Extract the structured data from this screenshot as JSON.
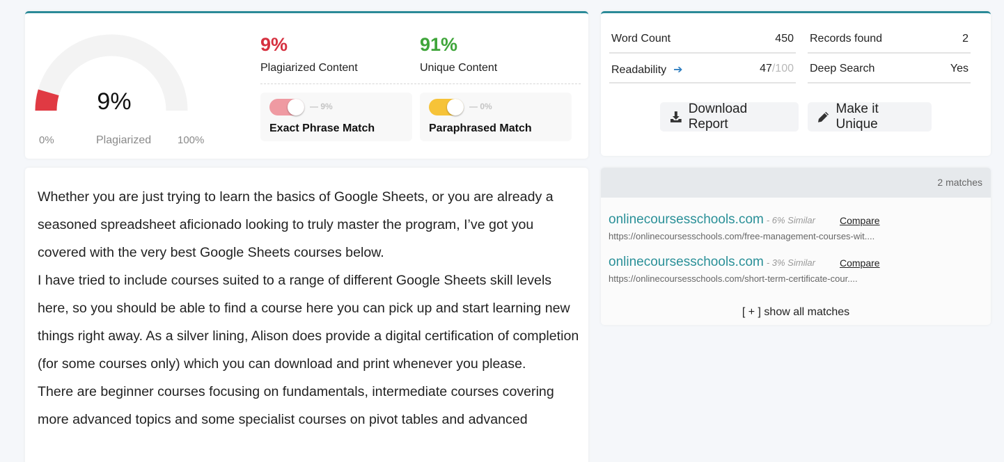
{
  "summary": {
    "gauge": {
      "value": 9,
      "value_text": "9%",
      "label": "Plagiarized",
      "min_label": "0%",
      "max_label": "100%",
      "fill_color": "#e03a43",
      "track_color": "#f3f3f3"
    },
    "plagiarized": {
      "pct": "9%",
      "label": "Plagiarized Content",
      "color": "#d6303f"
    },
    "unique": {
      "pct": "91%",
      "label": "Unique Content",
      "color": "#3fa53a"
    },
    "exact_match": {
      "toggle_on": true,
      "pct": "— 9%",
      "label": "Exact Phrase Match",
      "color": "#ef9aa2"
    },
    "paraphrased_match": {
      "toggle_on": true,
      "pct": "— 0%",
      "label": "Paraphrased Match",
      "color": "#f6c338"
    }
  },
  "info": {
    "word_count": {
      "label": "Word Count",
      "value": "450"
    },
    "readability": {
      "label": "Readability",
      "value": "47",
      "max": "/100",
      "icon": "arrow-right-icon"
    },
    "records_found": {
      "label": "Records found",
      "value": "2"
    },
    "deep_search": {
      "label": "Deep Search",
      "value": "Yes"
    },
    "download_button": {
      "label": "Download Report",
      "icon": "download-icon"
    },
    "unique_button": {
      "label": "Make it Unique",
      "icon": "pencil-icon"
    }
  },
  "matches": {
    "count_text": "2 matches",
    "items": [
      {
        "domain": "onlinecoursesschools.com",
        "similarity": "- 6% Similar",
        "compare_label": "Compare",
        "url": "https://onlinecoursesschools.com/free-management-courses-wit...."
      },
      {
        "domain": "onlinecoursesschools.com",
        "similarity": "- 3% Similar",
        "compare_label": "Compare",
        "url": "https://onlinecoursesschools.com/short-term-certificate-cour...."
      }
    ],
    "show_all_label": "[ + ] show all matches"
  },
  "content": {
    "paragraphs": [
      "Whether you are just trying to learn the basics of Google Sheets, or you are already a seasoned spreadsheet aficionado looking to truly master the program, I’ve got you covered with the very best Google Sheets courses below.",
      "I have tried to include courses suited to a range of different Google Sheets skill levels here, so you should be able to find a course here you can pick up and start learning new things right away.  As a silver lining, Alison does provide a digital certification of completion (for some courses only) which you can download and print whenever you please.",
      "There are beginner courses focusing on fundamentals, intermediate courses covering more advanced topics and some specialist courses on pivot tables and advanced"
    ]
  }
}
